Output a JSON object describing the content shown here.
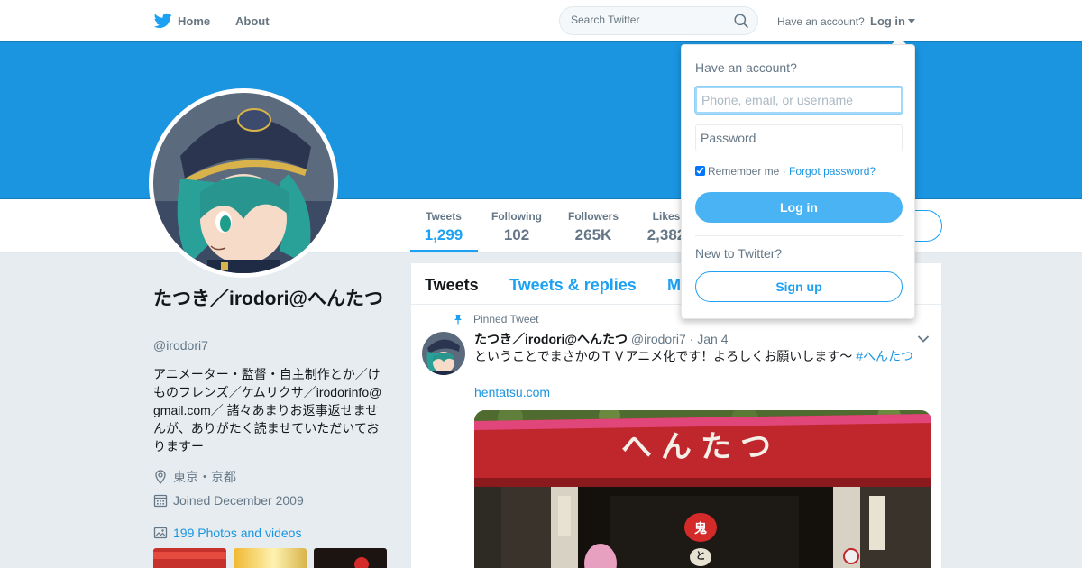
{
  "nav": {
    "home_label": "Home",
    "about_label": "About",
    "search_placeholder": "Search Twitter",
    "have_account_label": "Have an account?",
    "login_label": "Log in",
    "brand_color": "#1da1f2"
  },
  "banner": {
    "color": "#1b95e0"
  },
  "profile": {
    "name": "たつき／irodori@へんたつ",
    "handle": "@irodori7",
    "bio": "アニメーター・監督・自主制作とか／けものフレンズ／ケムリクサ／irodorinfo@gmail.com／ 諸々あまりお返事返せませんが、ありがたく読ませていただいておりますー",
    "location": "東京・京都",
    "joined": "Joined December 2009",
    "photos_label": "199 Photos and videos"
  },
  "stats": [
    {
      "label": "Tweets",
      "value": "1,299",
      "active": true
    },
    {
      "label": "Following",
      "value": "102",
      "active": false
    },
    {
      "label": "Followers",
      "value": "265K",
      "active": false
    },
    {
      "label": "Likes",
      "value": "2,382",
      "active": false
    }
  ],
  "timeline": {
    "tabs": [
      {
        "label": "Tweets",
        "active": true
      },
      {
        "label": "Tweets & replies",
        "active": false
      },
      {
        "label": "Media",
        "active": false
      }
    ],
    "pinned_label": "Pinned Tweet",
    "tweet": {
      "name": "たつき／irodori@へんたつ",
      "handle": "@irodori7",
      "separator": "·",
      "date": "Jan 4",
      "text": "ということでまさかのＴＶアニメ化です！よろしくお願いします～ ",
      "hashtag": "#へんたつ",
      "link": "hentatsu.com",
      "media_sign_text": "へんたつ",
      "media_badge_1": "鬼",
      "media_badge_2": "と"
    }
  },
  "login_dropdown": {
    "title": "Have an account?",
    "username_placeholder": "Phone, email, or username",
    "password_placeholder": "Password",
    "remember_label": "Remember me",
    "separator": "·",
    "forgot_label": "Forgot password?",
    "login_button": "Log in",
    "new_label": "New to Twitter?",
    "signup_button": "Sign up"
  },
  "icons": [
    "twitter-bird-icon",
    "search-icon",
    "caret-down-icon",
    "location-icon",
    "calendar-icon",
    "photo-icon",
    "pin-icon",
    "chevron-down-icon"
  ]
}
